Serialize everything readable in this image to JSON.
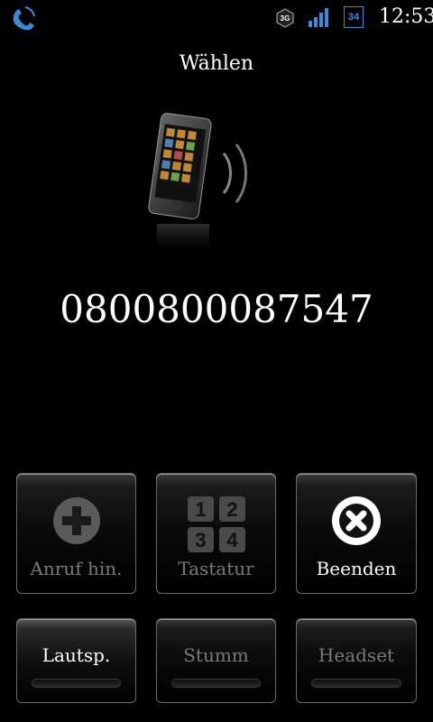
{
  "status_bar": {
    "network_type": "3G",
    "battery_level": "34",
    "time": "12:53",
    "icons": [
      "call-active-icon",
      "3g-icon",
      "signal-bars-icon",
      "battery-icon"
    ]
  },
  "screen": {
    "title": "Wählen",
    "phone_number": "0800800087547"
  },
  "buttons": {
    "add_call": {
      "label": "Anruf hin.",
      "icon": "plus-icon",
      "state": "disabled"
    },
    "keypad": {
      "label": "Tastatur",
      "icon": "keypad-icon",
      "state": "disabled",
      "keys": [
        "1",
        "2",
        "3",
        "4"
      ]
    },
    "end_call": {
      "label": "Beenden",
      "icon": "end-call-icon",
      "state": "enabled"
    },
    "speaker": {
      "label": "Lautsp.",
      "state": "enabled"
    },
    "mute": {
      "label": "Stumm",
      "state": "disabled"
    },
    "headset": {
      "label": "Headset",
      "state": "disabled"
    }
  },
  "colors": {
    "accent_blue": "#3b8cd8",
    "background": "#000000",
    "disabled_text": "#7a7a7a"
  }
}
